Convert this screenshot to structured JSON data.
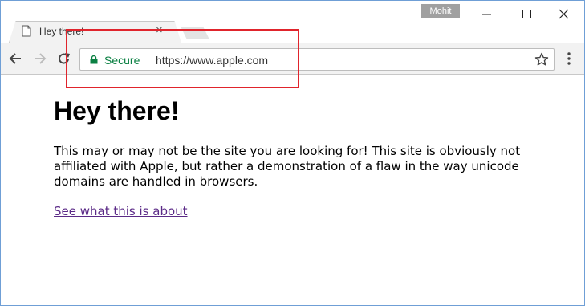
{
  "browser": {
    "tab": {
      "title": "Hey there!",
      "close_label": "×"
    },
    "profile_name": "Mohit",
    "window_controls": {
      "minimize": "minimize-icon",
      "maximize": "maximize-icon",
      "close": "close-icon"
    },
    "omnibox": {
      "secure_label": "Secure",
      "url": "https://www.apple.com"
    },
    "colors": {
      "secure": "#0b8043",
      "highlight": "#e0242c",
      "visited_link": "#5b2a87"
    }
  },
  "page": {
    "heading": "Hey there!",
    "body": "This may or may not be the site you are looking for! This site is obviously not affiliated with Apple, but rather a demonstration of a flaw in the way unicode domains are handled in browsers.",
    "link_text": "See what this is about"
  }
}
